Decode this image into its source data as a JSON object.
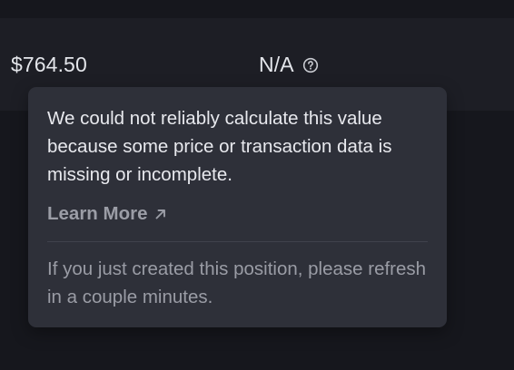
{
  "row": {
    "price": "$764.50",
    "pnl_value": "N/A"
  },
  "tooltip": {
    "message": "We could not reliably calculate this value because some price or transaction data is missing or incomplete.",
    "learn_more_label": "Learn More",
    "note": "If you just created this position, please refresh in a couple minutes."
  },
  "icons": {
    "help": "question-circle-icon",
    "external_link": "arrow-up-right-icon"
  },
  "colors": {
    "page_bg": "#16171d",
    "row_bg": "#1d1e25",
    "tooltip_bg": "#2e3039",
    "primary_text": "#e8e9ee",
    "muted_text": "#9a9ca5"
  }
}
